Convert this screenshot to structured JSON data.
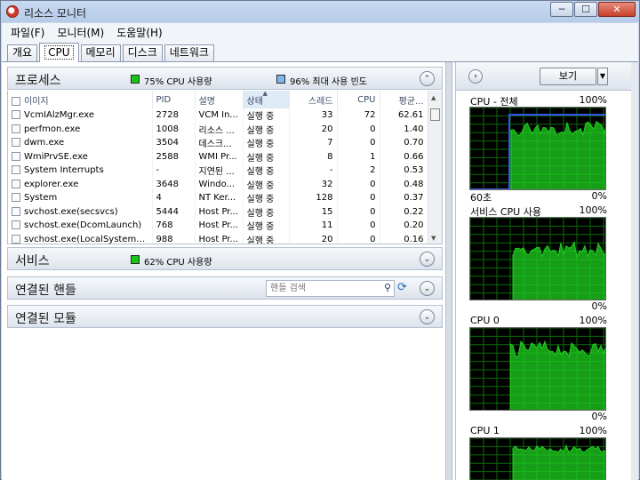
{
  "window": {
    "title": "리소스 모니터",
    "min_glyph": "─",
    "max_glyph": "☐",
    "close_glyph": "✕"
  },
  "menu": [
    "파일(F)",
    "모니터(M)",
    "도움말(H)"
  ],
  "tabs": [
    "개요",
    "CPU",
    "메모리",
    "디스크",
    "네트워크"
  ],
  "active_tab": "CPU",
  "processes": {
    "title": "프로세스",
    "legend1": {
      "text": "75% CPU 사용량",
      "color": "#16c516"
    },
    "legend2": {
      "text": "96% 최대 사용 빈도",
      "color": "#7fb6ec"
    },
    "collapse_glyph": "⌃",
    "columns": [
      "이미지",
      "PID",
      "설명",
      "상태",
      "스레드",
      "CPU",
      "평균..."
    ],
    "rows": [
      [
        "VcmIAlzMgr.exe",
        "2728",
        "VCM In...",
        "실행 중",
        "33",
        "72",
        "62.61"
      ],
      [
        "perfmon.exe",
        "1008",
        "리소스 ...",
        "실행 중",
        "20",
        "0",
        "1.40"
      ],
      [
        "dwm.exe",
        "3504",
        "데스크...",
        "실행 중",
        "7",
        "0",
        "0.70"
      ],
      [
        "WmiPrvSE.exe",
        "2588",
        "WMI Pr...",
        "실행 중",
        "8",
        "1",
        "0.66"
      ],
      [
        "System Interrupts",
        "-",
        "지연된 ...",
        "실행 중",
        "-",
        "2",
        "0.53"
      ],
      [
        "explorer.exe",
        "3648",
        "Windo...",
        "실행 중",
        "32",
        "0",
        "0.48"
      ],
      [
        "System",
        "4",
        "NT Ker...",
        "실행 중",
        "128",
        "0",
        "0.37"
      ],
      [
        "svchost.exe(secsvcs)",
        "5444",
        "Host Pr...",
        "실행 중",
        "15",
        "0",
        "0.22"
      ],
      [
        "svchost.exe(DcomLaunch)",
        "768",
        "Host Pr...",
        "실행 중",
        "11",
        "0",
        "0.20"
      ],
      [
        "svchost.exe(LocalSystemNetw...",
        "988",
        "Host Pr...",
        "실행 중",
        "20",
        "0",
        "0.16"
      ]
    ]
  },
  "services": {
    "title": "서비스",
    "legend": {
      "text": "62% CPU 사용량",
      "color": "#16c516"
    },
    "expand_glyph": "⌄"
  },
  "handles": {
    "title": "연결된 핸들",
    "search_placeholder": "핸들 검색",
    "expand_glyph": "⌄"
  },
  "modules": {
    "title": "연결된 모듈",
    "expand_glyph": "⌄"
  },
  "right_panel": {
    "nav_glyph": "›",
    "view_label": "보기",
    "view_drop_glyph": "▼",
    "graphs": [
      {
        "label": "CPU - 전체",
        "max": "100%",
        "bottom_left": "60초",
        "bottom_right": "0%"
      },
      {
        "label": "서비스 CPU 사용",
        "max": "100%",
        "bottom_left": "",
        "bottom_right": "0%"
      },
      {
        "label": "CPU 0",
        "max": "100%",
        "bottom_left": "",
        "bottom_right": "0%"
      },
      {
        "label": "CPU 1",
        "max": "100%",
        "bottom_left": "",
        "bottom_right": ""
      }
    ],
    "graph_color": "#1fd21f",
    "grid_color": "#0c6a0c",
    "max_line_color": "#3455e8"
  }
}
